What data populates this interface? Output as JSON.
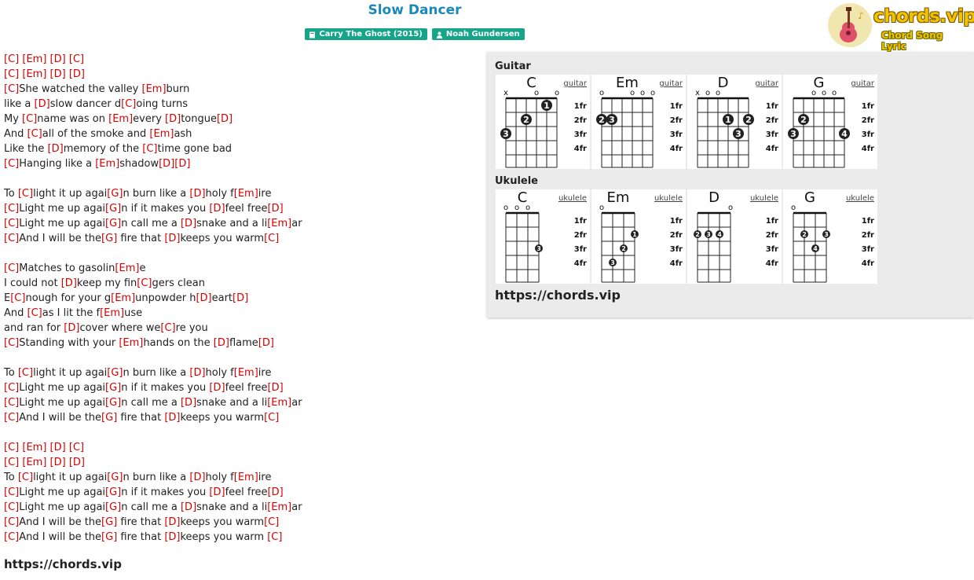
{
  "song": {
    "title": "Slow Dancer",
    "album": "Carry The Ghost (2015)",
    "artist": "Noah Gundersen"
  },
  "logo": {
    "main": "chords.vip",
    "sub": "Chord Song Lyric"
  },
  "lyrics": [
    [
      [
        "c",
        "[C]"
      ],
      [
        "t",
        " "
      ],
      [
        "c",
        "[Em]"
      ],
      [
        "t",
        " "
      ],
      [
        "c",
        "[D]"
      ],
      [
        "t",
        " "
      ],
      [
        "c",
        "[C]"
      ]
    ],
    [
      [
        "c",
        "[C]"
      ],
      [
        "t",
        " "
      ],
      [
        "c",
        "[Em]"
      ],
      [
        "t",
        " "
      ],
      [
        "c",
        "[D]"
      ],
      [
        "t",
        " "
      ],
      [
        "c",
        "[D]"
      ]
    ],
    [
      [
        "c",
        "[C]"
      ],
      [
        "t",
        "She watched the valley "
      ],
      [
        "c",
        "[Em]"
      ],
      [
        "t",
        "burn"
      ]
    ],
    [
      [
        "t",
        "like a "
      ],
      [
        "c",
        "[D]"
      ],
      [
        "t",
        "slow dancer d"
      ],
      [
        "c",
        "[C]"
      ],
      [
        "t",
        "oing turns"
      ]
    ],
    [
      [
        "t",
        "My "
      ],
      [
        "c",
        "[C]"
      ],
      [
        "t",
        "name was on "
      ],
      [
        "c",
        "[Em]"
      ],
      [
        "t",
        "every "
      ],
      [
        "c",
        "[D]"
      ],
      [
        "t",
        "tongue"
      ],
      [
        "c",
        "[D]"
      ]
    ],
    [
      [
        "t",
        "And "
      ],
      [
        "c",
        "[C]"
      ],
      [
        "t",
        "all of the smoke and "
      ],
      [
        "c",
        "[Em]"
      ],
      [
        "t",
        "ash"
      ]
    ],
    [
      [
        "t",
        "Like the "
      ],
      [
        "c",
        "[D]"
      ],
      [
        "t",
        "memory of the "
      ],
      [
        "c",
        "[C]"
      ],
      [
        "t",
        "time gone bad"
      ]
    ],
    [
      [
        "c",
        "[C]"
      ],
      [
        "t",
        "Hanging like a "
      ],
      [
        "c",
        "[Em]"
      ],
      [
        "t",
        "shadow"
      ],
      [
        "c",
        "[D]"
      ],
      [
        "c",
        "[D]"
      ]
    ],
    [],
    [
      [
        "t",
        "To "
      ],
      [
        "c",
        "[C]"
      ],
      [
        "t",
        "light it up agai"
      ],
      [
        "c",
        "[G]"
      ],
      [
        "t",
        "n burn like a "
      ],
      [
        "c",
        "[D]"
      ],
      [
        "t",
        "holy f"
      ],
      [
        "c",
        "[Em]"
      ],
      [
        "t",
        "ire"
      ]
    ],
    [
      [
        "c",
        "[C]"
      ],
      [
        "t",
        "Light me up agai"
      ],
      [
        "c",
        "[G]"
      ],
      [
        "t",
        "n if it makes you "
      ],
      [
        "c",
        "[D]"
      ],
      [
        "t",
        "feel free"
      ],
      [
        "c",
        "[D]"
      ]
    ],
    [
      [
        "c",
        "[C]"
      ],
      [
        "t",
        "Light me up agai"
      ],
      [
        "c",
        "[G]"
      ],
      [
        "t",
        "n call me a "
      ],
      [
        "c",
        "[D]"
      ],
      [
        "t",
        "snake and a li"
      ],
      [
        "c",
        "[Em]"
      ],
      [
        "t",
        "ar"
      ]
    ],
    [
      [
        "c",
        "[C]"
      ],
      [
        "t",
        "And I will be the"
      ],
      [
        "c",
        "[G]"
      ],
      [
        "t",
        " fire that "
      ],
      [
        "c",
        "[D]"
      ],
      [
        "t",
        "keeps you warm"
      ],
      [
        "c",
        "[C]"
      ]
    ],
    [],
    [
      [
        "c",
        "[C]"
      ],
      [
        "t",
        "Matches to gasolin"
      ],
      [
        "c",
        "[Em]"
      ],
      [
        "t",
        "e"
      ]
    ],
    [
      [
        "t",
        "I could not "
      ],
      [
        "c",
        "[D]"
      ],
      [
        "t",
        "keep my fin"
      ],
      [
        "c",
        "[C]"
      ],
      [
        "t",
        "gers clean"
      ]
    ],
    [
      [
        "t",
        "E"
      ],
      [
        "c",
        "[C]"
      ],
      [
        "t",
        "nough for your g"
      ],
      [
        "c",
        "[Em]"
      ],
      [
        "t",
        "unpowder h"
      ],
      [
        "c",
        "[D]"
      ],
      [
        "t",
        "eart"
      ],
      [
        "c",
        "[D]"
      ]
    ],
    [
      [
        "t",
        "And "
      ],
      [
        "c",
        "[C]"
      ],
      [
        "t",
        "as I lit the f"
      ],
      [
        "c",
        "[Em]"
      ],
      [
        "t",
        "use"
      ]
    ],
    [
      [
        "t",
        "and ran for "
      ],
      [
        "c",
        "[D]"
      ],
      [
        "t",
        "cover where we"
      ],
      [
        "c",
        "[C]"
      ],
      [
        "t",
        "re you"
      ]
    ],
    [
      [
        "c",
        "[C]"
      ],
      [
        "t",
        "Standing with your "
      ],
      [
        "c",
        "[Em]"
      ],
      [
        "t",
        "hands on the "
      ],
      [
        "c",
        "[D]"
      ],
      [
        "t",
        "flame"
      ],
      [
        "c",
        "[D]"
      ]
    ],
    [],
    [
      [
        "t",
        "To "
      ],
      [
        "c",
        "[C]"
      ],
      [
        "t",
        "light it up agai"
      ],
      [
        "c",
        "[G]"
      ],
      [
        "t",
        "n burn like a "
      ],
      [
        "c",
        "[D]"
      ],
      [
        "t",
        "holy f"
      ],
      [
        "c",
        "[Em]"
      ],
      [
        "t",
        "ire"
      ]
    ],
    [
      [
        "c",
        "[C]"
      ],
      [
        "t",
        "Light me up agai"
      ],
      [
        "c",
        "[G]"
      ],
      [
        "t",
        "n if it makes you "
      ],
      [
        "c",
        "[D]"
      ],
      [
        "t",
        "feel free"
      ],
      [
        "c",
        "[D]"
      ]
    ],
    [
      [
        "c",
        "[C]"
      ],
      [
        "t",
        "Light me up agai"
      ],
      [
        "c",
        "[G]"
      ],
      [
        "t",
        "n call me a "
      ],
      [
        "c",
        "[D]"
      ],
      [
        "t",
        "snake and a li"
      ],
      [
        "c",
        "[Em]"
      ],
      [
        "t",
        "ar"
      ]
    ],
    [
      [
        "c",
        "[C]"
      ],
      [
        "t",
        "And I will be the"
      ],
      [
        "c",
        "[G]"
      ],
      [
        "t",
        " fire that "
      ],
      [
        "c",
        "[D]"
      ],
      [
        "t",
        "keeps you warm"
      ],
      [
        "c",
        "[C]"
      ]
    ],
    [],
    [
      [
        "c",
        "[C]"
      ],
      [
        "t",
        " "
      ],
      [
        "c",
        "[Em]"
      ],
      [
        "t",
        " "
      ],
      [
        "c",
        "[D]"
      ],
      [
        "t",
        " "
      ],
      [
        "c",
        "[C]"
      ]
    ],
    [
      [
        "c",
        "[C]"
      ],
      [
        "t",
        " "
      ],
      [
        "c",
        "[Em]"
      ],
      [
        "t",
        " "
      ],
      [
        "c",
        "[D]"
      ],
      [
        "t",
        " "
      ],
      [
        "c",
        "[D]"
      ]
    ],
    [
      [
        "t",
        "To "
      ],
      [
        "c",
        "[C]"
      ],
      [
        "t",
        "light it up agai"
      ],
      [
        "c",
        "[G]"
      ],
      [
        "t",
        "n burn like a "
      ],
      [
        "c",
        "[D]"
      ],
      [
        "t",
        "holy f"
      ],
      [
        "c",
        "[Em]"
      ],
      [
        "t",
        "ire"
      ]
    ],
    [
      [
        "c",
        "[C]"
      ],
      [
        "t",
        "Light me up agai"
      ],
      [
        "c",
        "[G]"
      ],
      [
        "t",
        "n if it makes you "
      ],
      [
        "c",
        "[D]"
      ],
      [
        "t",
        "feel free"
      ],
      [
        "c",
        "[D]"
      ]
    ],
    [
      [
        "c",
        "[C]"
      ],
      [
        "t",
        "Light me up agai"
      ],
      [
        "c",
        "[G]"
      ],
      [
        "t",
        "n call me a "
      ],
      [
        "c",
        "[D]"
      ],
      [
        "t",
        "snake and a li"
      ],
      [
        "c",
        "[Em]"
      ],
      [
        "t",
        "ar"
      ]
    ],
    [
      [
        "c",
        "[C]"
      ],
      [
        "t",
        "And I will be the"
      ],
      [
        "c",
        "[G]"
      ],
      [
        "t",
        " fire that "
      ],
      [
        "c",
        "[D]"
      ],
      [
        "t",
        "keeps you warm"
      ],
      [
        "c",
        "[C]"
      ]
    ],
    [
      [
        "c",
        "[C]"
      ],
      [
        "t",
        "And I will be the"
      ],
      [
        "c",
        "[G]"
      ],
      [
        "t",
        " fire that "
      ],
      [
        "c",
        "[D]"
      ],
      [
        "t",
        "keeps you warm "
      ],
      [
        "c",
        "[C]"
      ]
    ]
  ],
  "footer_url": "https://chords.vip",
  "panel": {
    "guitar_label": "Guitar",
    "ukulele_label": "Ukulele",
    "url": "https://chords.vip",
    "fret_labels": [
      "1fr",
      "2fr",
      "3fr",
      "4fr"
    ],
    "guitar": [
      {
        "name": "C",
        "link": "guitar",
        "top": [
          "x",
          "",
          "",
          "o",
          "",
          "o"
        ],
        "dots": [
          [
            5,
            1,
            "1"
          ],
          [
            3,
            2,
            "2"
          ],
          [
            1,
            3,
            "3"
          ]
        ]
      },
      {
        "name": "Em",
        "link": "guitar",
        "top": [
          "o",
          "",
          "",
          "o",
          "o",
          "o"
        ],
        "dots": [
          [
            1,
            2,
            "2"
          ],
          [
            2,
            2,
            "3"
          ]
        ]
      },
      {
        "name": "D",
        "link": "guitar",
        "top": [
          "x",
          "o",
          "o",
          "",
          "",
          ""
        ],
        "dots": [
          [
            4,
            2,
            "1"
          ],
          [
            6,
            2,
            "2"
          ],
          [
            5,
            3,
            "3"
          ]
        ]
      },
      {
        "name": "G",
        "link": "guitar",
        "top": [
          "",
          "",
          "o",
          "o",
          "o",
          ""
        ],
        "dots": [
          [
            2,
            2,
            "2"
          ],
          [
            1,
            3,
            "3"
          ],
          [
            6,
            3,
            "4"
          ]
        ]
      }
    ],
    "ukulele": [
      {
        "name": "C",
        "link": "ukulele",
        "top": [
          "o",
          "o",
          "o",
          ""
        ],
        "dots": [
          [
            4,
            3,
            "3"
          ]
        ]
      },
      {
        "name": "Em",
        "link": "ukulele",
        "top": [
          "o",
          "",
          "",
          ""
        ],
        "dots": [
          [
            4,
            2,
            "1"
          ],
          [
            3,
            3,
            "2"
          ],
          [
            2,
            4,
            "3"
          ]
        ]
      },
      {
        "name": "D",
        "link": "ukulele",
        "top": [
          "",
          "",
          "",
          "o"
        ],
        "dots": [
          [
            1,
            2,
            "2"
          ],
          [
            2,
            2,
            "3"
          ],
          [
            3,
            2,
            "4"
          ]
        ]
      },
      {
        "name": "G",
        "link": "ukulele",
        "top": [
          "o",
          "",
          "",
          ""
        ],
        "dots": [
          [
            2,
            2,
            "2"
          ],
          [
            4,
            2,
            "3"
          ],
          [
            3,
            3,
            "4"
          ]
        ]
      }
    ]
  }
}
